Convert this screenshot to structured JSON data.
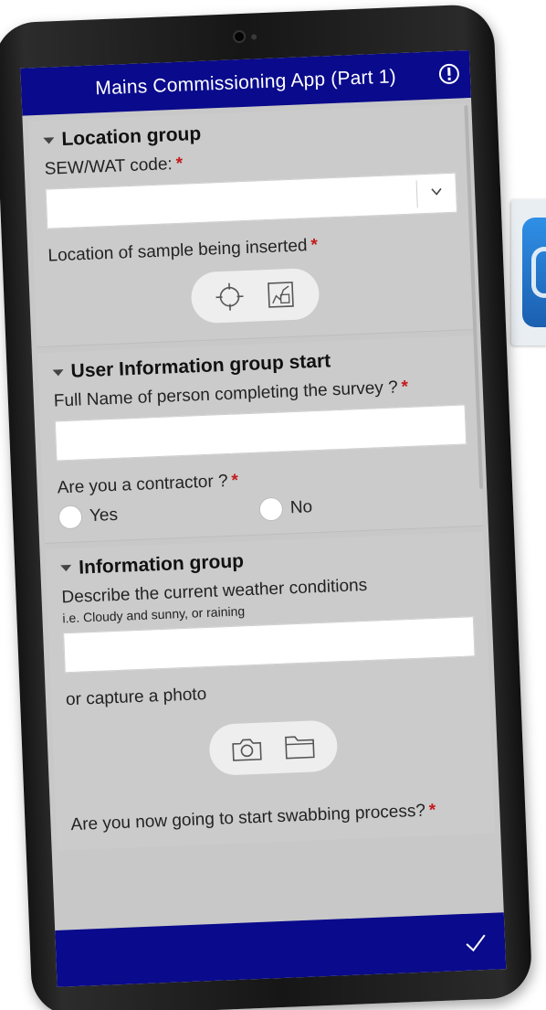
{
  "app": {
    "title": "Mains Commissioning App (Part 1)"
  },
  "icons": {
    "header_right": "warning-icon",
    "location_buttons": [
      "crosshair-icon",
      "map-icon"
    ],
    "photo_buttons": [
      "camera-icon",
      "folder-icon"
    ],
    "submit": "checkmark-icon",
    "select": "chevron-down-icon"
  },
  "colors": {
    "header": "#0a0a8c",
    "required": "#c41a1a",
    "form_bg": "#c8c8c8"
  },
  "location_group": {
    "title": "Location group",
    "sew_label": "SEW/WAT code:",
    "sew_required": "*",
    "sew_value": "",
    "location_label": "Location of sample being inserted",
    "location_required": "*"
  },
  "user_group": {
    "title": "User Information group start",
    "name_label": "Full Name of person completing the survey ?",
    "name_required": "*",
    "name_value": "",
    "contractor_label": "Are you a contractor ?",
    "contractor_required": "*",
    "options": [
      "Yes",
      "No"
    ]
  },
  "info_group": {
    "title": "Information group",
    "weather_label": "Describe the current weather conditions",
    "weather_hint": "i.e. Cloudy and sunny, or raining",
    "weather_value": "",
    "photo_label": "or capture a photo",
    "swab_label": "Are you now going to start swabbing process?",
    "swab_required": "*"
  }
}
